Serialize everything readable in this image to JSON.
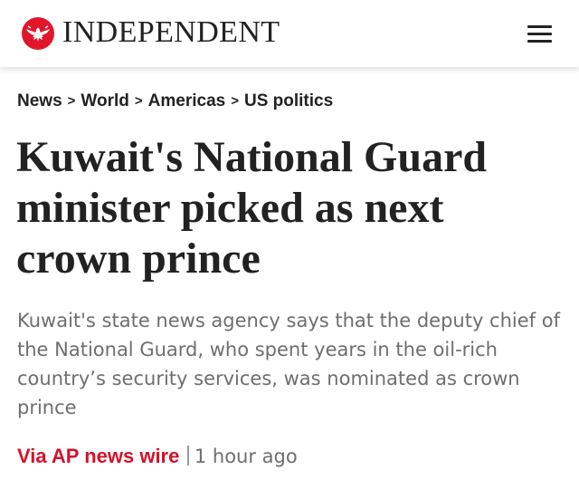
{
  "header": {
    "logo_text": "INDEPENDENT",
    "brand_color": "#e0162b",
    "logo_icon": "eagle-icon",
    "menu_icon": "hamburger-menu-icon"
  },
  "breadcrumb": {
    "items": [
      {
        "label": "News"
      },
      {
        "label": "World"
      },
      {
        "label": "Americas"
      },
      {
        "label": "US politics"
      }
    ],
    "separator": ">"
  },
  "article": {
    "headline": "Kuwait's National Guard minister picked as next crown prince",
    "standfirst": "Kuwait's state news agency says that the deputy chief of the National Guard, who spent years in the oil-rich country’s security services, was nominated as crown prince",
    "byline": {
      "author": "Via AP news wire",
      "author_color": "#d6112b",
      "time": "1 hour ago"
    }
  }
}
